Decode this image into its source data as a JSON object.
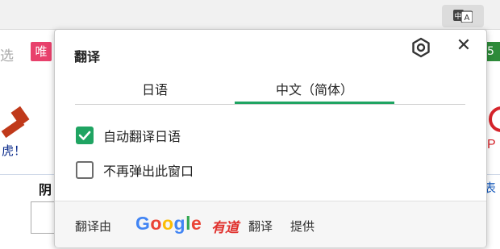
{
  "colors": {
    "accent": "#1fa462",
    "google_blue": "#4285f4",
    "google_red": "#ea4335",
    "google_yellow": "#fbbc05",
    "google_green": "#34a853",
    "youdao_red": "#e0312d"
  },
  "toolbar": {
    "translate_icon": "translate-icon",
    "icon_text": "中A"
  },
  "background": {
    "left_char": "选",
    "badge": "唯",
    "tiger_text": "虎！",
    "bold_char": "阴",
    "right_link": "表",
    "right_badge": "5"
  },
  "popup": {
    "title": "翻译",
    "settings_icon": "gear-icon",
    "close_icon": "close-icon",
    "close_glyph": "✕",
    "tabs": [
      {
        "label": "日语",
        "active": false
      },
      {
        "label": "中文（简体）",
        "active": true
      }
    ],
    "options": [
      {
        "label": "自动翻译日语",
        "checked": true
      },
      {
        "label": "不再弹出此窗口",
        "checked": false
      }
    ],
    "footer": {
      "prefix": "翻译由",
      "google_letters": [
        "G",
        "o",
        "o",
        "g",
        "l",
        "e"
      ],
      "youdao": "有道",
      "translate": "翻译",
      "suffix": "提供"
    }
  }
}
